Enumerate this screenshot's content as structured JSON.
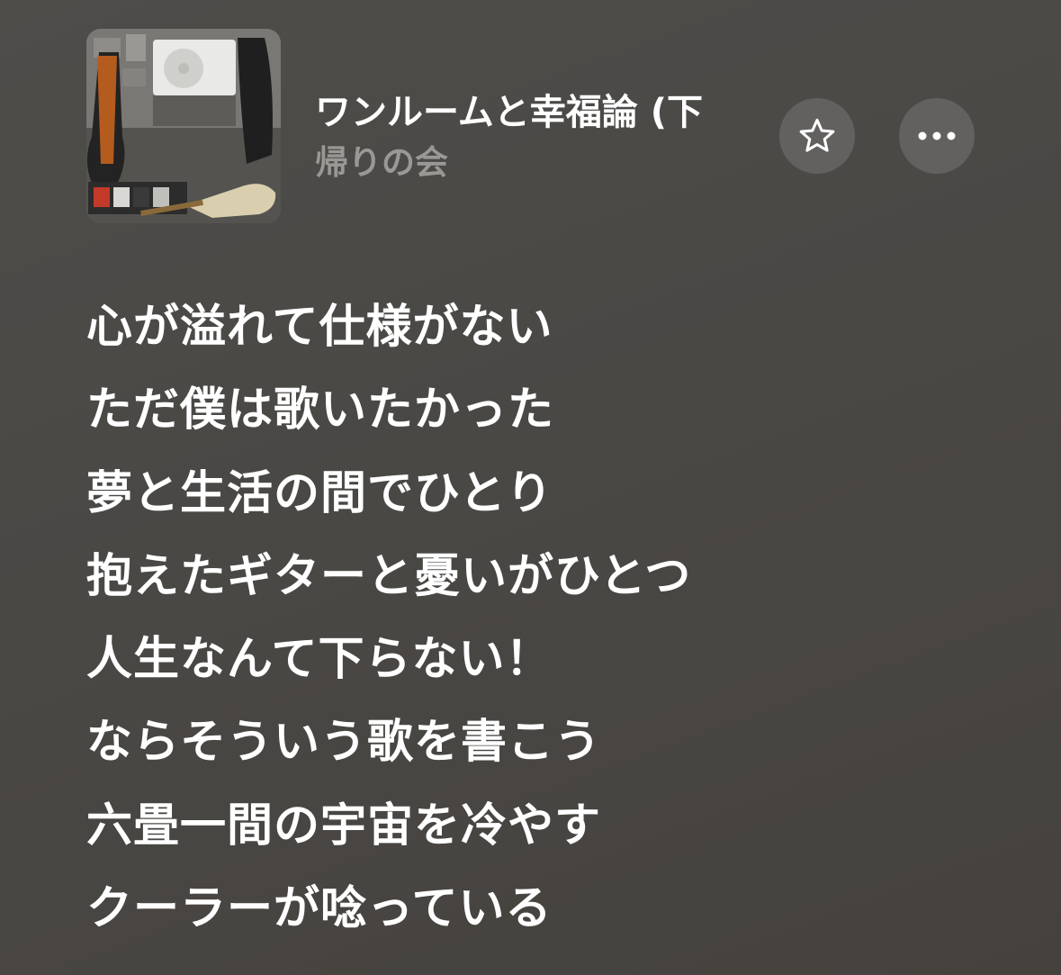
{
  "now_playing": {
    "title": "ワンルームと幸福論 (下",
    "artist": "帰りの会",
    "artwork_icon": "album-artwork",
    "favorite_icon": "star-outline-icon",
    "more_icon": "ellipsis-icon"
  },
  "lyrics": [
    "心が溢れて仕様がない",
    "ただ僕は歌いたかった",
    "夢と生活の間でひとり",
    "抱えたギターと憂いがひとつ",
    "人生なんて下らない！",
    "ならそういう歌を書こう",
    "六畳一間の宇宙を冷やす",
    "クーラーが唸っている"
  ],
  "colors": {
    "background": "#4a4845",
    "primary_text": "#ffffff",
    "secondary_text": "#9a9894",
    "button_bg": "#636160"
  }
}
